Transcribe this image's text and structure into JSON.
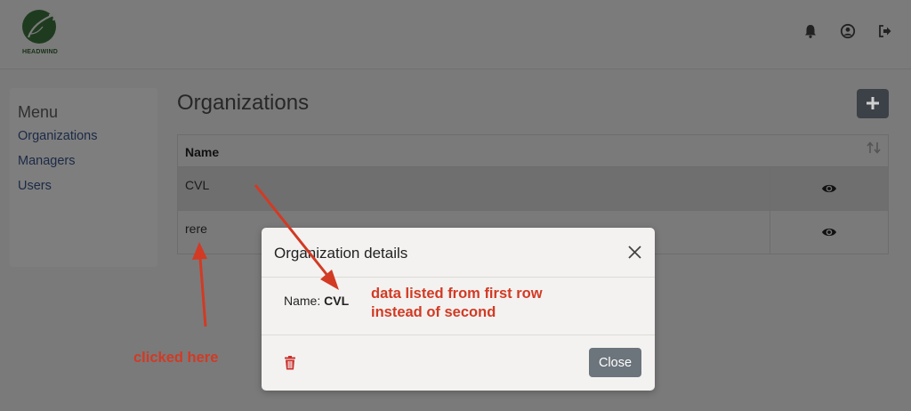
{
  "header": {
    "logo_text": "HEADWIND",
    "icons": [
      "bell-icon",
      "user-circle-icon",
      "logout-icon"
    ]
  },
  "sidebar": {
    "title": "Menu",
    "items": [
      {
        "label": "Organizations"
      },
      {
        "label": "Managers"
      },
      {
        "label": "Users"
      }
    ]
  },
  "main": {
    "title": "Organizations",
    "add_icon": "plus-icon",
    "table": {
      "columns": [
        "Name"
      ],
      "rows": [
        {
          "name": "CVL"
        },
        {
          "name": "rere"
        }
      ]
    }
  },
  "modal": {
    "title": "Organization details",
    "name_label": "Name:",
    "name_value": "CVL",
    "close_label": "Close"
  },
  "annotations": {
    "callout_top_line1": "data listed from first row",
    "callout_top_line2": "instead of second",
    "callout_bottom": "clicked here",
    "color": "#d23a24"
  },
  "colors": {
    "overlay": "#7a7a7a",
    "modal_bg": "#f3f2f0",
    "close_button": "#6c747c",
    "trash": "#c9302c",
    "add_button": "#3c4047"
  }
}
